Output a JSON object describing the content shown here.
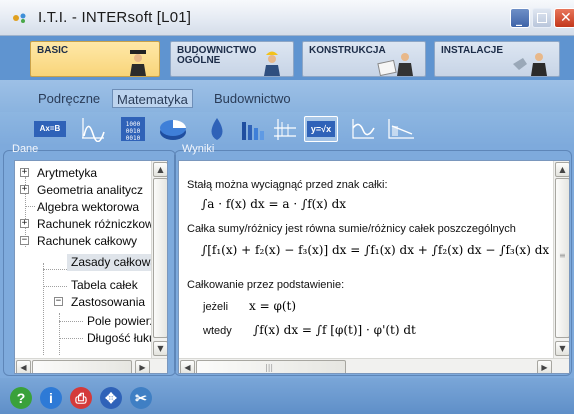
{
  "window": {
    "title": "I.T.I. - INTERsoft [L01]"
  },
  "categories": [
    {
      "label": "BASIC",
      "active": true
    },
    {
      "label": "BUDOWNICTWO OGÓLNE",
      "active": false
    },
    {
      "label": "KONSTRUKCJA",
      "active": false
    },
    {
      "label": "INSTALACJE",
      "active": false
    }
  ],
  "subtabs": [
    {
      "label": "Podręczne",
      "active": false
    },
    {
      "label": "Matematyka",
      "active": true
    },
    {
      "label": "Budownictwo",
      "active": false
    }
  ],
  "toolbar": {
    "tools": [
      "equation-icon",
      "curve-icon",
      "matrix-icon",
      "pie-chart-icon",
      "drop-icon",
      "bar-chart-icon",
      "axes-icon",
      "root-icon",
      "wave-icon",
      "area-icon"
    ],
    "active_tool": "root-icon",
    "equation_label": "Ax=B",
    "root_label": "y=√x"
  },
  "panels": {
    "tree_label": "Dane",
    "results_label": "Wyniki"
  },
  "tree": [
    {
      "label": "Arytmetyka",
      "level": 0,
      "toggle": "+"
    },
    {
      "label": "Geometria analitycz",
      "level": 0,
      "toggle": "+"
    },
    {
      "label": "Algebra wektorowa",
      "level": 0,
      "toggle": ""
    },
    {
      "label": "Rachunek różniczkowy",
      "level": 0,
      "toggle": "+"
    },
    {
      "label": "Rachunek całkowy",
      "level": 0,
      "toggle": "−"
    },
    {
      "label": "Zasady całkowania",
      "level": 1,
      "toggle": "",
      "selected": true
    },
    {
      "label": "Tabela całek",
      "level": 1,
      "toggle": ""
    },
    {
      "label": "Zastosowania",
      "level": 1,
      "toggle": "−"
    },
    {
      "label": "Pole powierzchni",
      "level": 2,
      "toggle": ""
    },
    {
      "label": "Długość łuku",
      "level": 2,
      "toggle": ""
    }
  ],
  "results": {
    "line1": "Stałą można wyciągnąć przed znak całki:",
    "eq1": "∫a · f(x) dx = a · ∫f(x) dx",
    "line2": "Całka sumy/różnicy jest równa sumie/różnicy całek poszczególnych",
    "eq2": "∫[f₁(x) + f₂(x) − f₃(x)] dx = ∫f₁(x) dx + ∫f₂(x) dx − ∫f₃(x) dx",
    "line3": "Całkowanie przez podstawienie:",
    "if_label": "jeżeli",
    "eq3": "x = φ(t)",
    "then_label": "wtedy",
    "eq4": "∫f(x) dx = ∫f [φ(t)] · φ'(t) dt"
  },
  "footer": {
    "buttons": [
      {
        "name": "help-icon",
        "glyph": "?",
        "color": "#3aa13a"
      },
      {
        "name": "info-icon",
        "glyph": "i",
        "color": "#2e7ad6"
      },
      {
        "name": "print-icon",
        "glyph": "⎙",
        "color": "#d43a3a"
      },
      {
        "name": "navigate-icon",
        "glyph": "✥",
        "color": "#2f62b8"
      },
      {
        "name": "tools-icon",
        "glyph": "✂",
        "color": "#3f7fc4"
      }
    ]
  }
}
